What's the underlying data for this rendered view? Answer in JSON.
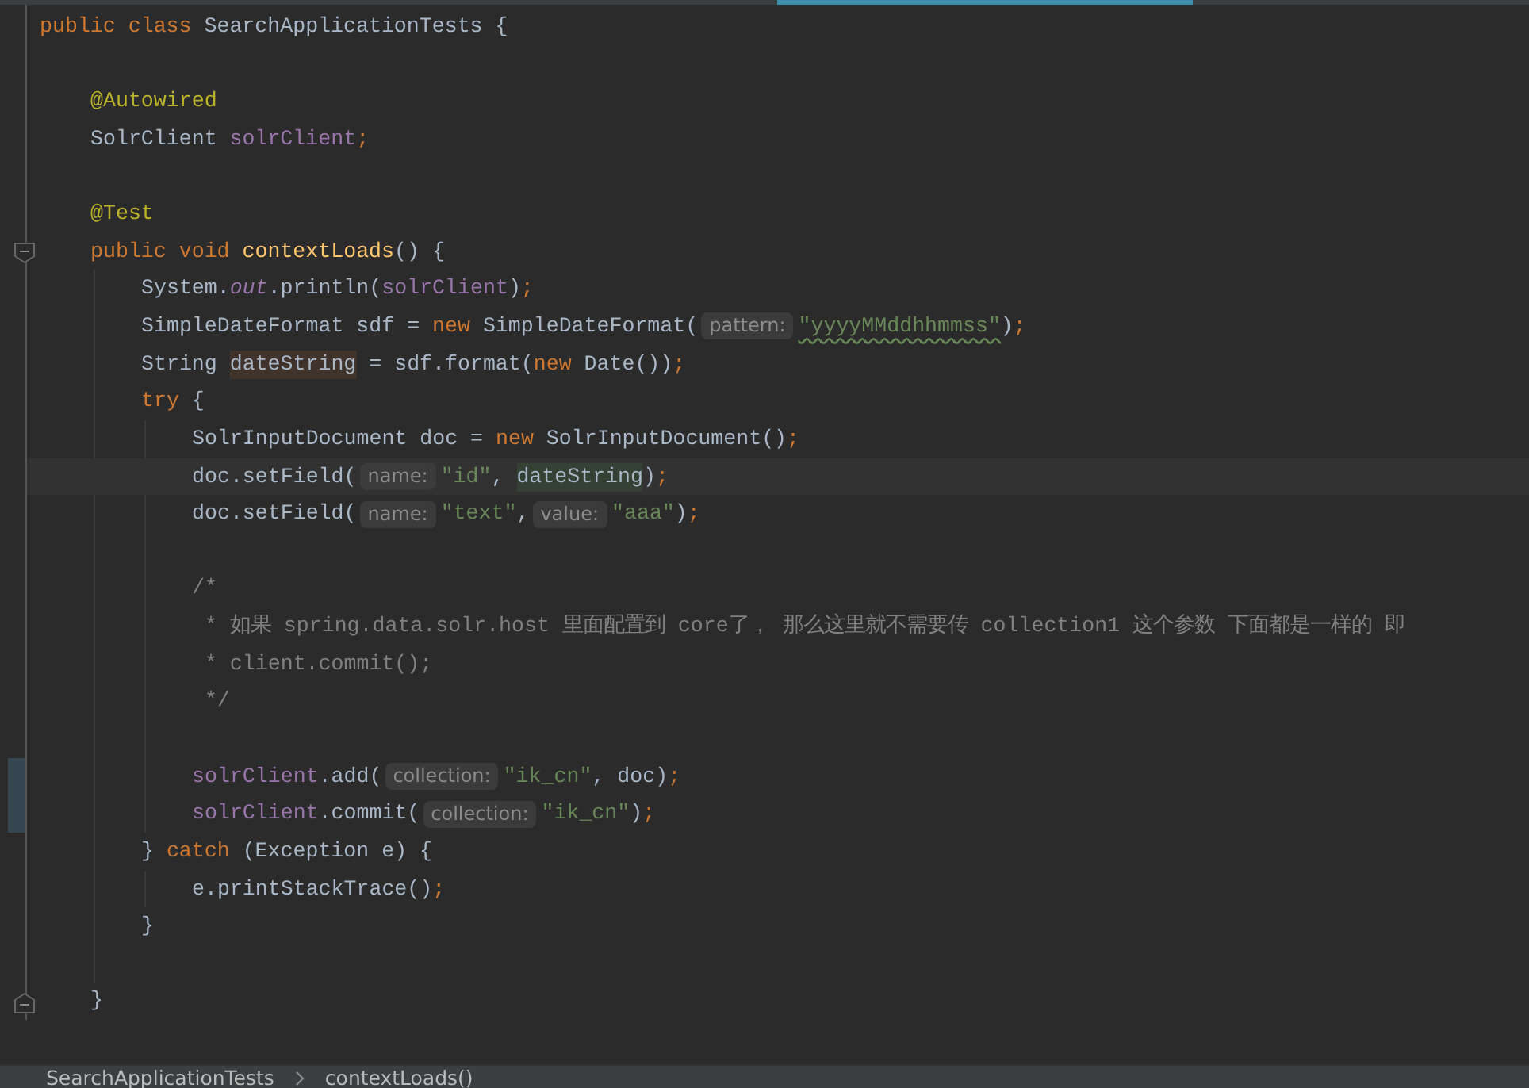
{
  "editor": {
    "lines": [
      {
        "kind": "code",
        "tokens": [
          {
            "kind": "keyword",
            "text": "public"
          },
          {
            "kind": "keyword",
            "text": "class",
            "gap": true
          },
          {
            "kind": "plain",
            "text": "SearchApplicationTests",
            "gap": true
          },
          {
            "kind": "plain",
            "text": "{",
            "gap": true
          }
        ],
        "children": [
          {
            "kind": "blank"
          },
          {
            "kind": "code",
            "tokens": [
              {
                "kind": "annotation",
                "text": "@Autowired"
              }
            ]
          },
          {
            "kind": "code",
            "tokens": [
              {
                "kind": "plain",
                "text": "SolrClient"
              },
              {
                "kind": "field",
                "text": "solrClient",
                "gap": true
              },
              {
                "kind": "semicolon",
                "text": ";"
              }
            ]
          },
          {
            "kind": "blank"
          },
          {
            "kind": "code",
            "tokens": [
              {
                "kind": "annotation",
                "text": "@Test"
              }
            ]
          },
          {
            "kind": "code",
            "fold_open": true,
            "tokens": [
              {
                "kind": "keyword",
                "text": "public"
              },
              {
                "kind": "keyword",
                "text": "void",
                "gap": true
              },
              {
                "kind": "method",
                "text": "contextLoads",
                "gap": true
              },
              {
                "kind": "plain",
                "text": "()"
              },
              {
                "kind": "plain",
                "text": "{",
                "gap": true
              }
            ],
            "children": [
              {
                "kind": "code",
                "tokens": [
                  {
                    "kind": "plain",
                    "text": "System."
                  },
                  {
                    "kind": "static",
                    "text": "out"
                  },
                  {
                    "kind": "plain",
                    "text": ".println("
                  },
                  {
                    "kind": "field",
                    "text": "solrClient"
                  },
                  {
                    "kind": "plain",
                    "text": ")"
                  },
                  {
                    "kind": "semicolon",
                    "text": ";"
                  }
                ]
              },
              {
                "kind": "code",
                "tokens": [
                  {
                    "kind": "plain",
                    "text": "SimpleDateFormat sdf ="
                  },
                  {
                    "kind": "keyword",
                    "text": "new",
                    "gap": true
                  },
                  {
                    "kind": "plain",
                    "text": "SimpleDateFormat(",
                    "gap": true
                  },
                  {
                    "kind": "hint",
                    "text": "pattern:"
                  },
                  {
                    "kind": "string",
                    "text": "\"yyyyMMddhhmmss\"",
                    "typo": true
                  },
                  {
                    "kind": "plain",
                    "text": ")"
                  },
                  {
                    "kind": "semicolon",
                    "text": ";"
                  }
                ]
              },
              {
                "kind": "code",
                "tokens": [
                  {
                    "kind": "plain",
                    "text": "String"
                  },
                  {
                    "kind": "plain",
                    "text": "dateString",
                    "gap": true,
                    "write_usage": true
                  },
                  {
                    "kind": "plain",
                    "text": "= sdf.format(",
                    "gap": true
                  },
                  {
                    "kind": "keyword",
                    "text": "new"
                  },
                  {
                    "kind": "plain",
                    "text": "Date())",
                    "gap": true
                  },
                  {
                    "kind": "semicolon",
                    "text": ";"
                  }
                ]
              },
              {
                "kind": "code",
                "tokens": [
                  {
                    "kind": "keyword",
                    "text": "try"
                  },
                  {
                    "kind": "plain",
                    "text": "{",
                    "gap": true
                  }
                ],
                "children": [
                  {
                    "kind": "code",
                    "tokens": [
                      {
                        "kind": "plain",
                        "text": "SolrInputDocument doc ="
                      },
                      {
                        "kind": "keyword",
                        "text": "new",
                        "gap": true
                      },
                      {
                        "kind": "plain",
                        "text": "SolrInputDocument()",
                        "gap": true
                      },
                      {
                        "kind": "semicolon",
                        "text": ";"
                      }
                    ]
                  },
                  {
                    "kind": "code",
                    "current": true,
                    "tokens": [
                      {
                        "kind": "plain",
                        "text": "doc.setField("
                      },
                      {
                        "kind": "hint",
                        "text": "name:"
                      },
                      {
                        "kind": "string",
                        "text": "\"id\""
                      },
                      {
                        "kind": "plain",
                        "text": ","
                      },
                      {
                        "kind": "plain",
                        "text": "dateString",
                        "gap": true,
                        "read_usage": true
                      },
                      {
                        "kind": "plain",
                        "text": ")"
                      },
                      {
                        "kind": "semicolon",
                        "text": ";"
                      }
                    ]
                  },
                  {
                    "kind": "code",
                    "tokens": [
                      {
                        "kind": "plain",
                        "text": "doc.setField("
                      },
                      {
                        "kind": "hint",
                        "text": "name:"
                      },
                      {
                        "kind": "string",
                        "text": "\"text\""
                      },
                      {
                        "kind": "plain",
                        "text": ","
                      },
                      {
                        "kind": "hint",
                        "text": "value:",
                        "gap": true
                      },
                      {
                        "kind": "string",
                        "text": "\"aaa\""
                      },
                      {
                        "kind": "plain",
                        "text": ")"
                      },
                      {
                        "kind": "semicolon",
                        "text": ";"
                      }
                    ]
                  },
                  {
                    "kind": "blank"
                  },
                  {
                    "kind": "code",
                    "tokens": [
                      {
                        "kind": "comment",
                        "text": "/*"
                      }
                    ]
                  },
                  {
                    "kind": "code",
                    "tokens": [
                      {
                        "kind": "comment",
                        "text": "* 如果 spring.data.solr.host 里面配置到 core了， 那么这里就不需要传 collection1 这个参数 下面都是一样的 即",
                        "gap": true
                      }
                    ]
                  },
                  {
                    "kind": "code",
                    "tokens": [
                      {
                        "kind": "comment",
                        "text": "* client.commit();",
                        "gap": true
                      }
                    ]
                  },
                  {
                    "kind": "code",
                    "tokens": [
                      {
                        "kind": "comment",
                        "text": "*/",
                        "gap": true
                      }
                    ]
                  },
                  {
                    "kind": "blank"
                  },
                  {
                    "kind": "code",
                    "changed": true,
                    "tokens": [
                      {
                        "kind": "field",
                        "text": "solrClient"
                      },
                      {
                        "kind": "plain",
                        "text": ".add("
                      },
                      {
                        "kind": "hint",
                        "text": "collection:"
                      },
                      {
                        "kind": "string",
                        "text": "\"ik_cn\""
                      },
                      {
                        "kind": "plain",
                        "text": ","
                      },
                      {
                        "kind": "plain",
                        "text": "doc)",
                        "gap": true
                      },
                      {
                        "kind": "semicolon",
                        "text": ";"
                      }
                    ]
                  },
                  {
                    "kind": "code",
                    "changed": true,
                    "tokens": [
                      {
                        "kind": "field",
                        "text": "solrClient"
                      },
                      {
                        "kind": "plain",
                        "text": ".commit("
                      },
                      {
                        "kind": "hint",
                        "text": "collection:"
                      },
                      {
                        "kind": "string",
                        "text": "\"ik_cn\""
                      },
                      {
                        "kind": "plain",
                        "text": ")"
                      },
                      {
                        "kind": "semicolon",
                        "text": ";"
                      }
                    ]
                  }
                ]
              },
              {
                "kind": "code",
                "tokens": [
                  {
                    "kind": "plain",
                    "text": "}"
                  },
                  {
                    "kind": "keyword",
                    "text": "catch",
                    "gap": true
                  },
                  {
                    "kind": "plain",
                    "text": "(Exception e)",
                    "gap": true
                  },
                  {
                    "kind": "plain",
                    "text": "{",
                    "gap": true
                  }
                ],
                "children": [
                  {
                    "kind": "code",
                    "tokens": [
                      {
                        "kind": "plain",
                        "text": "e.printStackTrace()"
                      },
                      {
                        "kind": "semicolon",
                        "text": ";"
                      }
                    ]
                  }
                ]
              },
              {
                "kind": "code",
                "tokens": [
                  {
                    "kind": "plain",
                    "text": "}"
                  }
                ]
              },
              {
                "kind": "blank"
              }
            ]
          },
          {
            "kind": "code",
            "fold_close": true,
            "tokens": [
              {
                "kind": "plain",
                "text": "}"
              }
            ]
          }
        ]
      }
    ]
  },
  "breadcrumb": [
    "SearchApplicationTests",
    "contextLoads()"
  ]
}
